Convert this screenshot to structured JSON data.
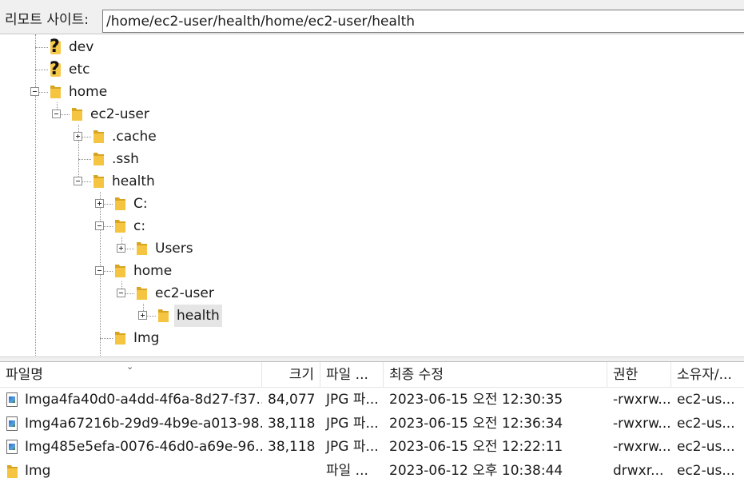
{
  "remote_site": {
    "label": "리모트 사이트:",
    "path": "/home/ec2-user/health/home/ec2-user/health"
  },
  "tree": {
    "nodes": [
      {
        "label": "dev",
        "icon": "unknown-icon"
      },
      {
        "label": "etc",
        "icon": "unknown-icon"
      },
      {
        "label": "home",
        "icon": "folder-icon",
        "toggle": "minus"
      },
      {
        "label": "ec2-user",
        "icon": "folder-icon",
        "toggle": "minus"
      },
      {
        "label": ".cache",
        "icon": "folder-icon",
        "toggle": "plus"
      },
      {
        "label": ".ssh",
        "icon": "folder-icon"
      },
      {
        "label": "health",
        "icon": "folder-icon",
        "toggle": "minus"
      },
      {
        "label": "C:",
        "icon": "folder-icon",
        "toggle": "plus"
      },
      {
        "label": "c:",
        "icon": "folder-icon",
        "toggle": "minus"
      },
      {
        "label": "Users",
        "icon": "folder-icon",
        "toggle": "plus"
      },
      {
        "label": "home",
        "icon": "folder-icon",
        "toggle": "minus"
      },
      {
        "label": "ec2-user",
        "icon": "folder-icon",
        "toggle": "minus"
      },
      {
        "label": "health",
        "icon": "folder-icon",
        "toggle": "plus",
        "selected": true
      },
      {
        "label": "Img",
        "icon": "folder-icon"
      }
    ]
  },
  "filelist": {
    "columns": [
      "파일명",
      "크기",
      "파일 ...",
      "최종 수정",
      "권한",
      "소유자/..."
    ],
    "rows": [
      {
        "icon": "image-file-icon",
        "name": "Imga4fa40d0-a4dd-4f6a-8d27-f37...",
        "size": "84,077",
        "type": "JPG 파...",
        "modified": "2023-06-15 오전 12:30:35",
        "perms": "-rwxrw...",
        "owner": "ec2-us..."
      },
      {
        "icon": "image-file-icon",
        "name": "Img4a67216b-29d9-4b9e-a013-98...",
        "size": "38,118",
        "type": "JPG 파...",
        "modified": "2023-06-15 오전 12:36:34",
        "perms": "-rwxrw...",
        "owner": "ec2-us..."
      },
      {
        "icon": "image-file-icon",
        "name": "Img485e5efa-0076-46d0-a69e-96...",
        "size": "38,118",
        "type": "JPG 파...",
        "modified": "2023-06-15 오전 12:22:11",
        "perms": "-rwxrw...",
        "owner": "ec2-us..."
      },
      {
        "icon": "folder-icon",
        "name": "Img",
        "size": "",
        "type": "파일 ...",
        "modified": "2023-06-12 오후 10:38:44",
        "perms": "drwxr...",
        "owner": "ec2-us..."
      }
    ]
  },
  "colors": {
    "folder": "#f5c542",
    "folder_dark": "#d9a520",
    "selected_bg": "#e5e5e5"
  }
}
